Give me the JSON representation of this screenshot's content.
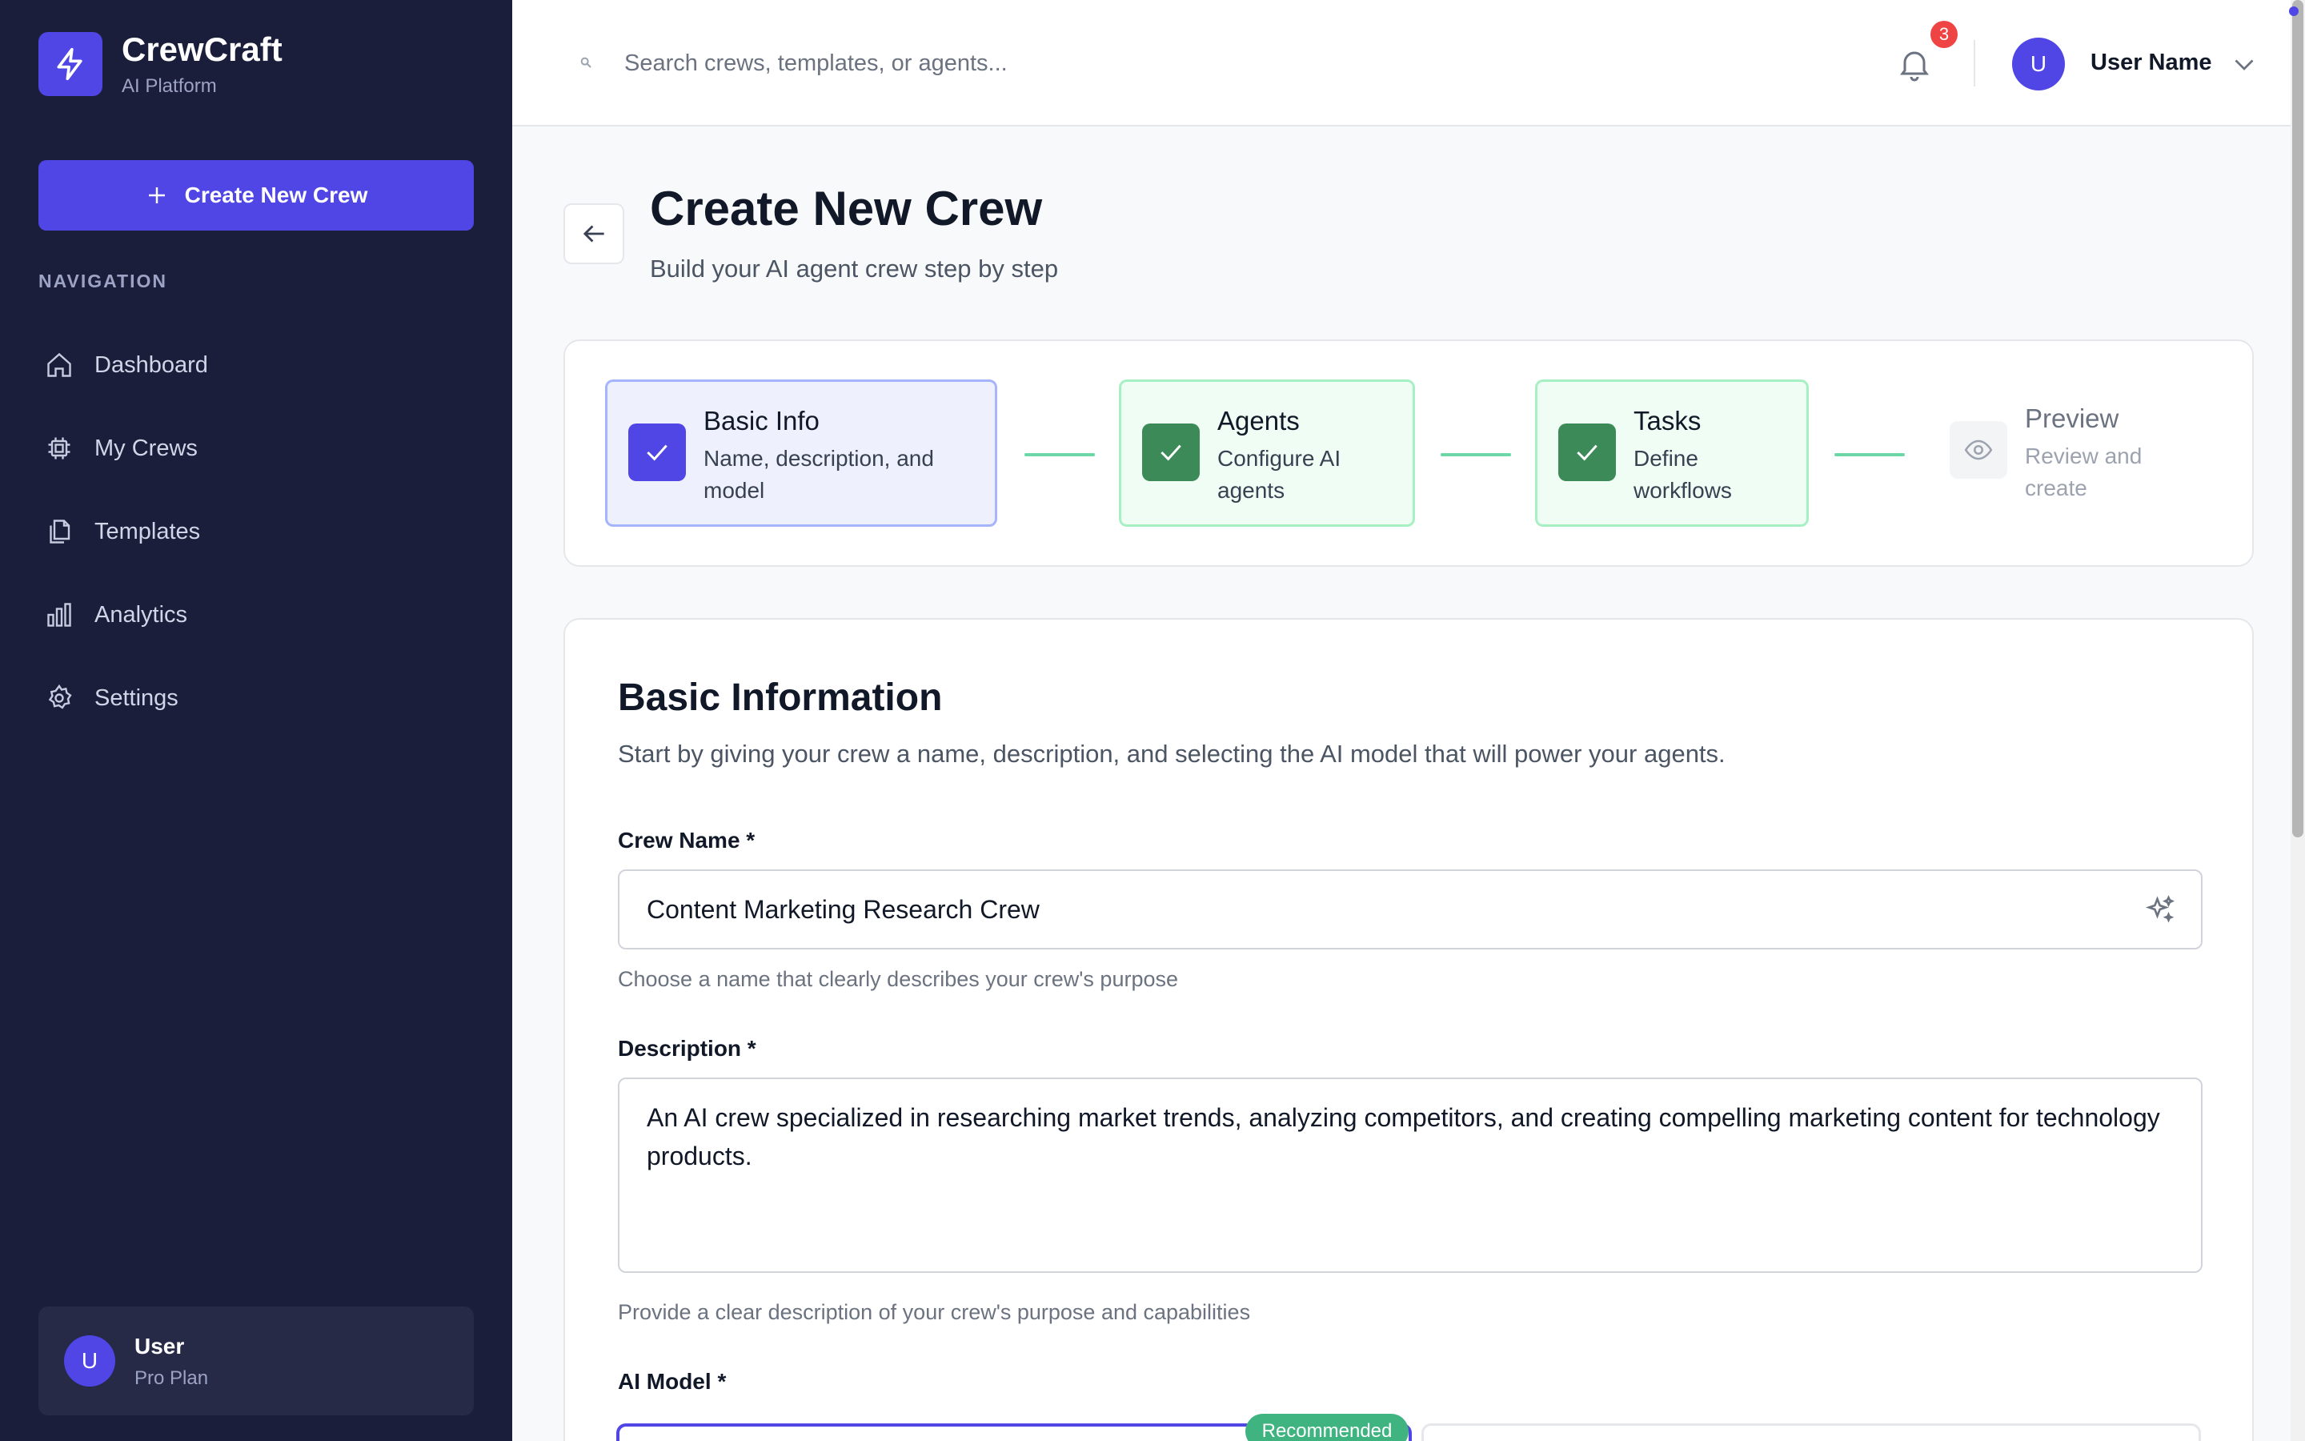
{
  "brand": {
    "name": "CrewCraft",
    "sub": "AI Platform"
  },
  "sidebar": {
    "create_label": "Create New Crew",
    "nav_heading": "NAVIGATION",
    "items": [
      {
        "label": "Dashboard",
        "icon": "home-icon"
      },
      {
        "label": "My Crews",
        "icon": "chip-icon"
      },
      {
        "label": "Templates",
        "icon": "documents-icon"
      },
      {
        "label": "Analytics",
        "icon": "bar-chart-icon"
      },
      {
        "label": "Settings",
        "icon": "gear-icon"
      }
    ],
    "user": {
      "initial": "U",
      "name": "User",
      "plan": "Pro Plan"
    }
  },
  "topbar": {
    "search_placeholder": "Search crews, templates, or agents...",
    "notifications": "3",
    "avatar_initial": "U",
    "username": "User Name"
  },
  "header": {
    "title": "Create New Crew",
    "subtitle": "Build your AI agent crew step by step"
  },
  "steps": [
    {
      "title": "Basic Info",
      "desc": "Name, description, and model",
      "state": "active"
    },
    {
      "title": "Agents",
      "desc": "Configure AI agents",
      "state": "done"
    },
    {
      "title": "Tasks",
      "desc": "Define workflows",
      "state": "done"
    },
    {
      "title": "Preview",
      "desc": "Review and create",
      "state": "pending"
    }
  ],
  "form": {
    "title": "Basic Information",
    "desc": "Start by giving your crew a name, description, and selecting the AI model that will power your agents.",
    "crew_name": {
      "label": "Crew Name *",
      "value": "Content Marketing Research Crew",
      "hint": "Choose a name that clearly describes your crew's purpose"
    },
    "description": {
      "label": "Description *",
      "value": "An AI crew specialized in researching market trends, analyzing competitors, and creating compelling marketing content for technology products.",
      "hint": "Provide a clear description of your crew's purpose and capabilities"
    },
    "model": {
      "label": "AI Model *",
      "badge": "Recommended"
    }
  },
  "colors": {
    "accent": "#4f46e5",
    "sidebar": "#1b1e3a",
    "success": "#3b8a57",
    "badge": "#ef4444"
  }
}
